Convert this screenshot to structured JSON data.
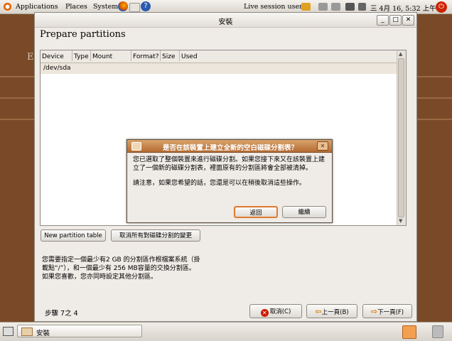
{
  "top_panel": {
    "menus": [
      "Applications",
      "Places",
      "System"
    ],
    "user_label": "Live session user",
    "clock": "三 4月 16, 5:32 上午",
    "colors": {
      "panel": "#e4e0d9",
      "accent": "#e16a12"
    }
  },
  "desktop": {
    "partial_text": "E:"
  },
  "window": {
    "title": "安裝",
    "heading": "Prepare partitions",
    "table": {
      "columns": [
        "Device",
        "Type",
        "Mount point",
        "Format?",
        "Size",
        "Used"
      ],
      "rows": [
        {
          "device": "/dev/sda"
        }
      ]
    },
    "buttons": {
      "new_partition_table": "New partition table",
      "undo_changes": "取消所有對磁碟分割的變更",
      "cancel": "取消(C)",
      "back": "上一頁(B)",
      "forward": "下一頁(F)"
    },
    "help_text": [
      "您需要指定一個最少有2 GB 的分割區作根檔案系統（掛",
      "載點“/”），和一個最少有 256 MB容量的交換分割區。",
      "如果您喜歡，您亦同時設定其他分割區。"
    ],
    "step": "步驟 7之 4"
  },
  "dialog": {
    "title": "是否在該裝置上建立全新的空白磁碟分割表？",
    "body_1": "您已選取了整個裝置來進行磁碟分割。如果您接下來又在該裝置上建立了一個新的磁碟分割表，裡面原有的分割區將會全部被清掉。",
    "body_2": "請注意，如果您希望的話，您還是可以在稍後取消這些操作。",
    "buttons": {
      "back": "返回",
      "continue": "繼續"
    }
  },
  "bottom_panel": {
    "task_label": "安裝"
  }
}
